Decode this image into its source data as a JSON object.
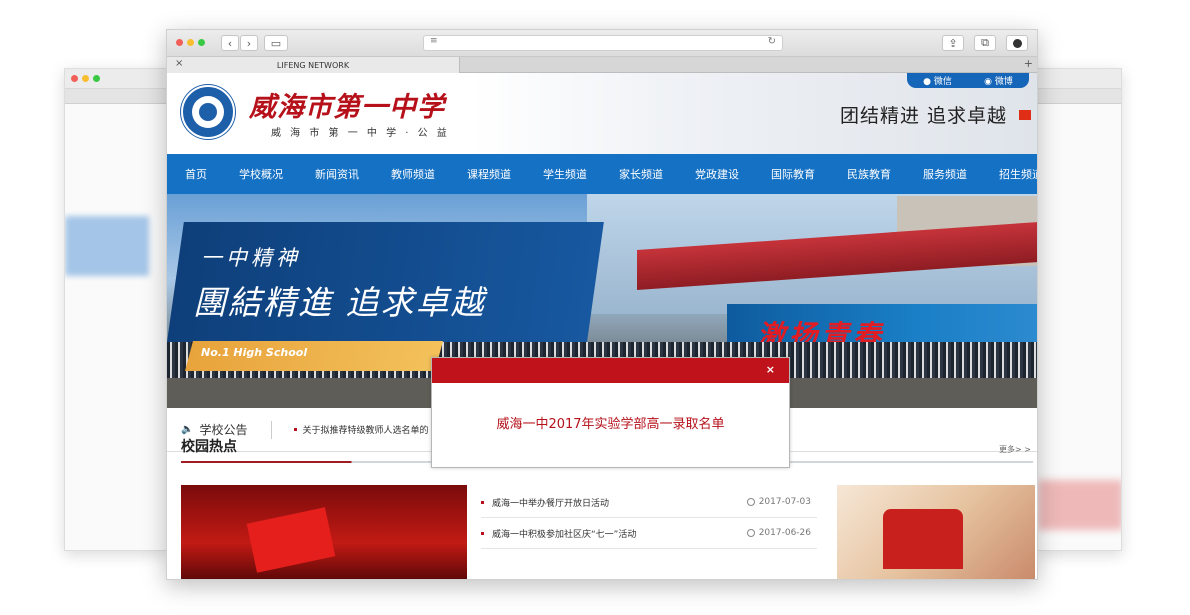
{
  "browser": {
    "tab_title": "LIFENG NETWORK",
    "new_tab": "+",
    "close_tab": "×"
  },
  "header": {
    "school_name": "威海市第一中学",
    "school_sub": "威 海 市 第 一 中 学 · 公 益",
    "motto": "团结精进  追求卓越",
    "social": {
      "wechat": "微信",
      "weibo": "微博"
    }
  },
  "nav": {
    "items": [
      "首页",
      "学校概况",
      "新闻资讯",
      "教师频道",
      "课程频道",
      "学生频道",
      "家长频道",
      "党政建设",
      "国际教育",
      "民族教育",
      "服务频道",
      "招生频道"
    ]
  },
  "banner": {
    "slogan_small": "一中精神",
    "slogan_big": "團結精進 追求卓越",
    "english": "No.1 High School",
    "stadium_text": "激扬青春"
  },
  "notice": {
    "label": "学校公告",
    "item": "关于拟推荐特级教师人选名单的"
  },
  "hot": {
    "title": "校园热点",
    "more": "更多> >",
    "news": [
      {
        "title": "威海一中举办餐厅开放日活动",
        "date": "2017-07-03"
      },
      {
        "title": "威海一中积极参加社区庆“七一”活动",
        "date": "2017-06-26"
      }
    ]
  },
  "modal": {
    "close": "×",
    "message": "威海一中2017年实验学部高一录取名单"
  },
  "colors": {
    "nav_blue": "#1571c4",
    "brand_red": "#b6111a",
    "modal_red": "#c0121a"
  }
}
